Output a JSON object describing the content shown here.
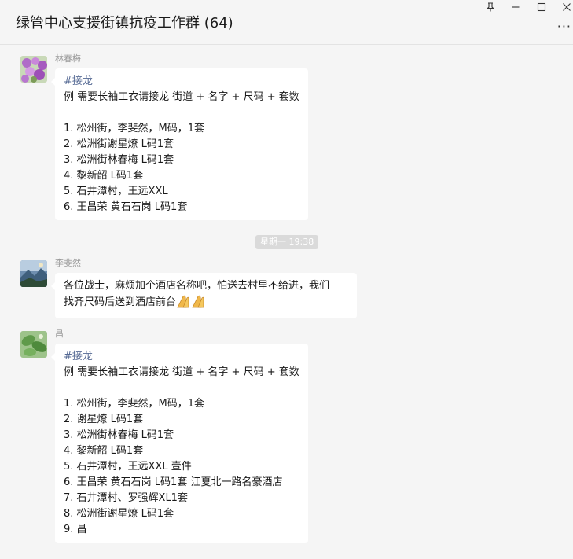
{
  "window": {
    "title": "绿管中心支援街镇抗疫工作群 (64)",
    "controls": [
      "pin-icon",
      "minimize-icon",
      "maximize-icon",
      "close-icon"
    ],
    "more_icon": "more-icon"
  },
  "messages": [
    {
      "sender": "林春梅",
      "avatar": "purple-flowers-avatar",
      "lines": [
        "#接龙",
        "例 需要长袖工衣请接龙 街道 + 名字 + 尺码 + 套数",
        "",
        "1. 松州街，李斐然，M码，1套",
        "2. 松洲街谢星燎 L码1套",
        "3. 松洲街林春梅 L码1套",
        "4. 黎新韶 L码1套",
        "5. 石井潭村，王远XXL",
        "6. 王昌荣 黄石石岗  L码1套"
      ]
    },
    {
      "timestamp": "星期一 19:38"
    },
    {
      "sender": "李斐然",
      "avatar": "landscape-avatar",
      "lines": [
        "各位战士，麻烦加个酒店名称吧，怕送去村里不给进，我们",
        "找齐尺码后送到酒店前台"
      ],
      "trailing_emoji": "praying-hands-icon"
    },
    {
      "sender": "昌",
      "avatar": "green-plant-avatar",
      "lines": [
        "#接龙",
        "例 需要长袖工衣请接龙 街道 + 名字 + 尺码 + 套数",
        "",
        "1. 松州街，李斐然，M码，1套",
        "2. 谢星燎 L码1套",
        "3. 松洲街林春梅 L码1套",
        "4. 黎新韶 L码1套",
        "5. 石井潭村，王远XXL  壹件",
        "6. 王昌荣 黄石石岗  L码1套  江夏北一路名豪酒店",
        "7. 石井潭村、罗强辉XL1套",
        "8. 松洲街谢星燎 L码1套",
        "9. 昌"
      ]
    }
  ],
  "colors": {
    "background": "#f5f5f5",
    "bubble": "#ffffff",
    "hashtag": "#576b95",
    "sender_name": "#9a9a9a",
    "timestamp_bg": "#dadada"
  }
}
